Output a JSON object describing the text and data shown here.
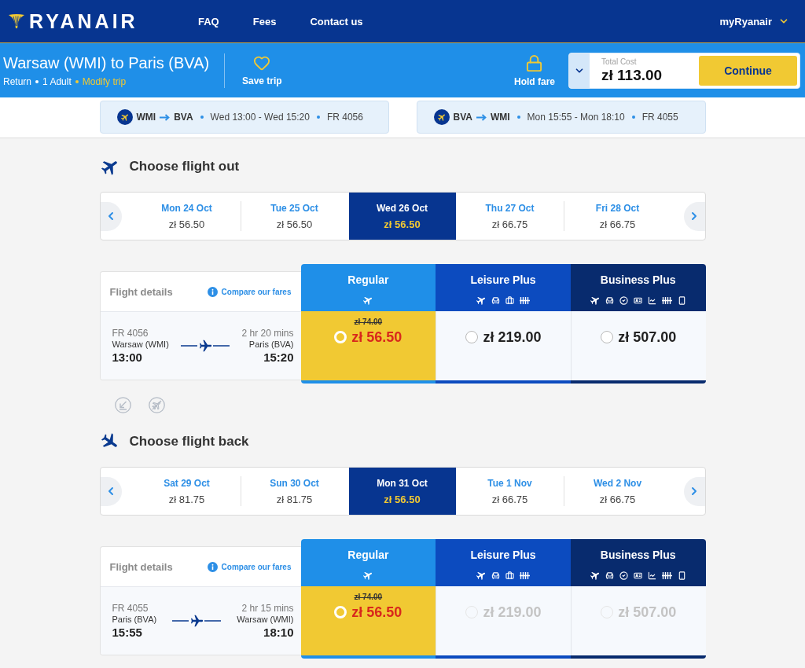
{
  "header": {
    "logo": "RYANAIR",
    "nav": [
      {
        "label": "FAQ"
      },
      {
        "label": "Fees"
      },
      {
        "label": "Contact us"
      }
    ],
    "account": "myRyanair"
  },
  "trip": {
    "title": "Warsaw (WMI) to Paris (BVA)",
    "details": [
      "Return",
      "1 Adult"
    ],
    "modify_link": "Modify trip",
    "save_label": "Save trip",
    "hold_label": "Hold fare",
    "total_label": "Total Cost",
    "total": "zł 113.00",
    "continue_label": "Continue"
  },
  "summaries": [
    {
      "from": "WMI",
      "to": "BVA",
      "times": "Wed 13:00 - Wed 15:20",
      "flight": "FR 4056"
    },
    {
      "from": "BVA",
      "to": "WMI",
      "times": "Mon 15:55 - Mon 18:10",
      "flight": "FR 4055"
    }
  ],
  "journeys": [
    {
      "kind": "out",
      "heading": "Choose flight out",
      "dates": [
        {
          "date": "Mon 24 Oct",
          "price": "zł 56.50",
          "selected": false
        },
        {
          "date": "Tue 25 Oct",
          "price": "zł 56.50",
          "selected": false
        },
        {
          "date": "Wed 26 Oct",
          "price": "zł 56.50",
          "selected": true
        },
        {
          "date": "Thu 27 Oct",
          "price": "zł 66.75",
          "selected": false
        },
        {
          "date": "Fri 28 Oct",
          "price": "zł 66.75",
          "selected": false
        }
      ],
      "details_label": "Flight details",
      "compare_link": "Compare our fares",
      "flight": {
        "number": "FR 4056",
        "origin": "Warsaw (WMI)",
        "departure": "13:00",
        "duration": "2 hr 20 mins",
        "destination": "Paris (BVA)",
        "arrival": "15:20"
      },
      "fares": [
        {
          "kind": "regular",
          "name": "Regular",
          "old_price": "zł 74.00",
          "price": "zł 56.50",
          "selected": true,
          "disabled": false
        },
        {
          "kind": "leisure",
          "name": "Leisure Plus",
          "price": "zł 219.00",
          "selected": false,
          "disabled": false
        },
        {
          "kind": "business",
          "name": "Business Plus",
          "price": "zł 507.00",
          "selected": false,
          "disabled": false
        }
      ]
    },
    {
      "kind": "back",
      "heading": "Choose flight back",
      "dates": [
        {
          "date": "Sat 29 Oct",
          "price": "zł 81.75",
          "selected": false
        },
        {
          "date": "Sun 30 Oct",
          "price": "zł 81.75",
          "selected": false
        },
        {
          "date": "Mon 31 Oct",
          "price": "zł 56.50",
          "selected": true
        },
        {
          "date": "Tue 1 Nov",
          "price": "zł 66.75",
          "selected": false
        },
        {
          "date": "Wed 2 Nov",
          "price": "zł 66.75",
          "selected": false
        }
      ],
      "details_label": "Flight details",
      "compare_link": "Compare our fares",
      "flight": {
        "number": "FR 4055",
        "origin": "Paris (BVA)",
        "departure": "15:55",
        "duration": "2 hr 15 mins",
        "destination": "Warsaw (WMI)",
        "arrival": "18:10"
      },
      "fares": [
        {
          "kind": "regular",
          "name": "Regular",
          "old_price": "zł 74.00",
          "price": "zł 56.50",
          "selected": true,
          "disabled": false
        },
        {
          "kind": "leisure",
          "name": "Leisure Plus",
          "price": "zł 219.00",
          "selected": false,
          "disabled": true
        },
        {
          "kind": "business",
          "name": "Business Plus",
          "price": "zł 507.00",
          "selected": false,
          "disabled": true
        }
      ]
    }
  ]
}
